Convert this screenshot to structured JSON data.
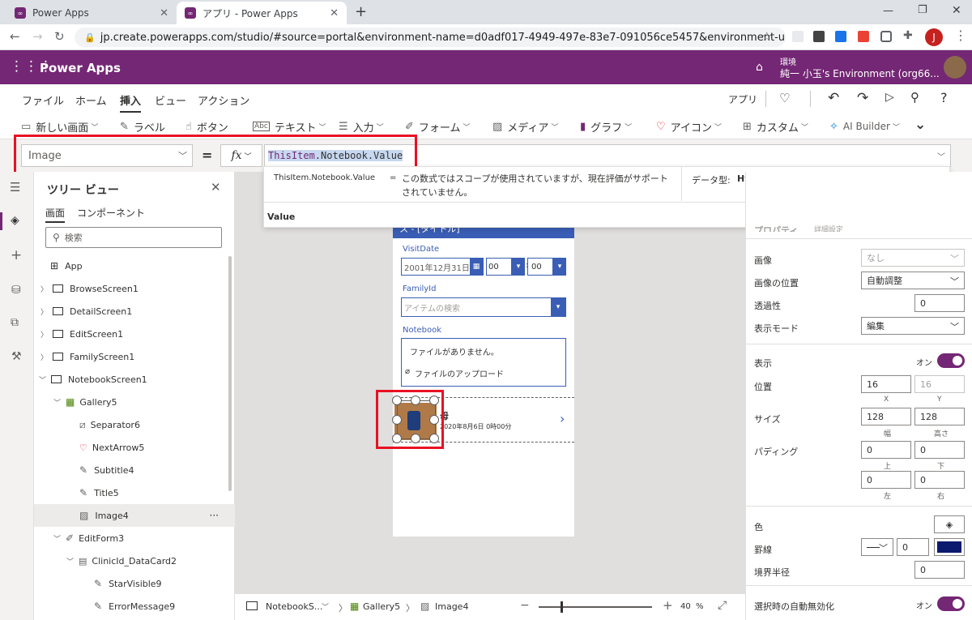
{
  "browser": {
    "tabs": [
      {
        "title": "Power Apps"
      },
      {
        "title": "アプリ - Power Apps"
      }
    ],
    "url": "jp.create.powerapps.com/studio/#source=portal&environment-name=d0adf017-4949-497e-83e7-091056ce5457&environment-update-cadence=...",
    "profile_initial": "J"
  },
  "appbar": {
    "title": "Power Apps",
    "env_label": "環境",
    "env_name": "純一 小玉's Environment (org66..."
  },
  "menu": {
    "items": [
      "ファイル",
      "ホーム",
      "挿入",
      "ビュー",
      "アクション"
    ],
    "active": "挿入",
    "app_label": "アプリ"
  },
  "ribbon": {
    "items": [
      "新しい画面",
      "ラベル",
      "ボタン",
      "テキスト",
      "入力",
      "フォーム",
      "メディア",
      "グラフ",
      "アイコン",
      "カスタム",
      "AI Builder"
    ]
  },
  "formula": {
    "property": "Image",
    "equals": "=",
    "fx": "fx",
    "expression_parts": [
      "ThisItem",
      ".Notebook.Value"
    ],
    "popup_expr": "ThisItem.Notebook.Value",
    "popup_eq": "=",
    "popup_message": "この数式ではスコープが使用されていますが、現在評価がサポートされていません。",
    "popup_type_label": "データ型:",
    "popup_type": "Hyperlink",
    "popup_suggestion": "Value"
  },
  "tree": {
    "title": "ツリー ビュー",
    "tab_screens": "画面",
    "tab_components": "コンポーネント",
    "search_placeholder": "検索",
    "items": [
      {
        "label": "App"
      },
      {
        "label": "BrowseScreen1"
      },
      {
        "label": "DetailScreen1"
      },
      {
        "label": "EditScreen1"
      },
      {
        "label": "FamilyScreen1"
      },
      {
        "label": "NotebookScreen1"
      },
      {
        "label": "Gallery5"
      },
      {
        "label": "Separator6"
      },
      {
        "label": "NextArrow5"
      },
      {
        "label": "Subtitle4"
      },
      {
        "label": "Title5"
      },
      {
        "label": "Image4"
      },
      {
        "label": "EditForm3"
      },
      {
        "label": "ClinicId_DataCard2"
      },
      {
        "label": "StarVisible9"
      },
      {
        "label": "ErrorMessage9"
      }
    ],
    "more": "···"
  },
  "canvas": {
    "header_text": "ス - [タイトル]",
    "visit_date_label": "VisitDate",
    "visit_date_value": "2001年12月31日",
    "hour_value": "00",
    "minute_value": "00",
    "time_sep": ":",
    "family_label": "FamilyId",
    "family_placeholder": "アイテムの検索",
    "notebook_label": "Notebook",
    "no_file": "ファイルがありません。",
    "upload": "ファイルのアップロード",
    "gallery_title": "母",
    "gallery_subtitle": "2020年8月6日 0時00分"
  },
  "props": {
    "tab_props": "プロパティ",
    "tab_adv": "詳細設定",
    "image_label": "画像",
    "image_value": "なし",
    "image_pos_label": "画像の位置",
    "image_pos_value": "自動調整",
    "transparency_label": "透過性",
    "transparency_value": "0",
    "display_mode_label": "表示モード",
    "display_mode_value": "編集",
    "visible_label": "表示",
    "visible_value": "オン",
    "position_label": "位置",
    "pos_x": "16",
    "pos_y": "16",
    "x_label": "X",
    "y_label": "Y",
    "size_label": "サイズ",
    "width": "128",
    "height": "128",
    "width_label": "幅",
    "height_label": "高さ",
    "padding_label": "パディング",
    "pad_top": "0",
    "pad_bottom": "0",
    "pad_left": "0",
    "pad_right": "0",
    "top_label": "上",
    "bottom_label": "下",
    "left_label": "左",
    "right_label": "右",
    "color_label": "色",
    "border_label": "罫線",
    "border_value": "0",
    "radius_label": "境界半径",
    "radius_value": "0",
    "auto_disable_label": "選択時の自動無効化",
    "auto_disable_value": "オン",
    "border_color": "#0b1a6e"
  },
  "bottombar": {
    "screen": "NotebookS...",
    "gallery": "Gallery5",
    "image": "Image4",
    "zoom": "40",
    "zoom_unit": "%"
  }
}
